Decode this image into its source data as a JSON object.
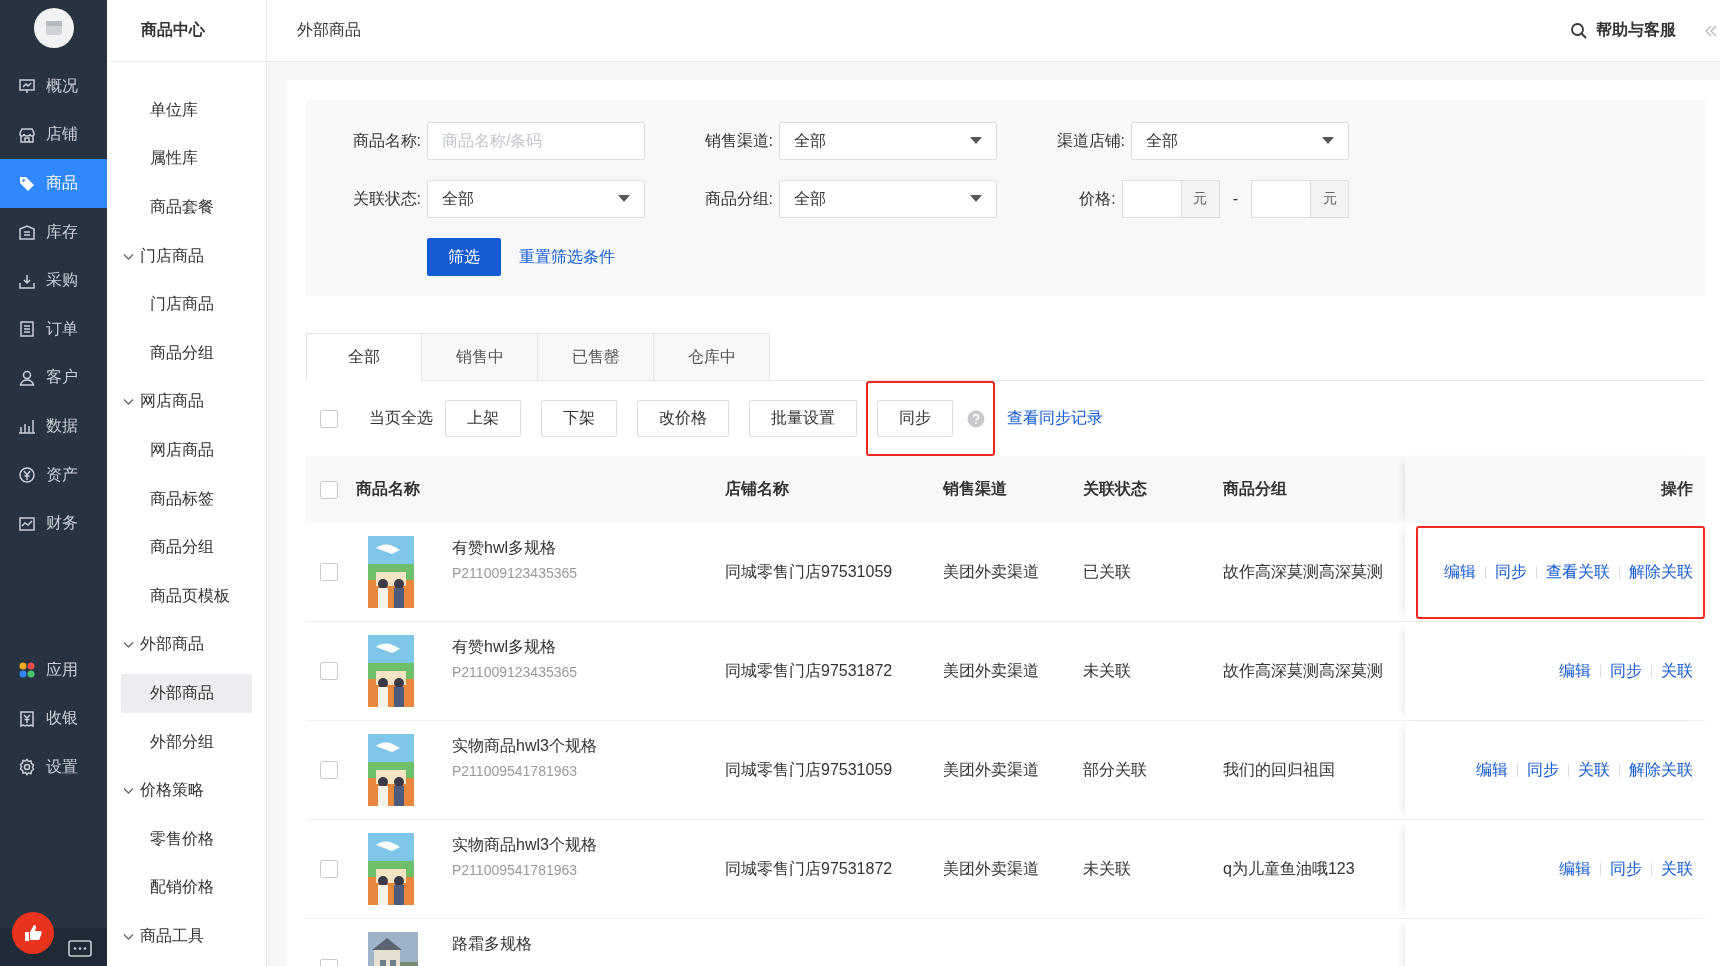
{
  "nav": {
    "items": [
      {
        "label": "概况",
        "selected": false
      },
      {
        "label": "店铺",
        "selected": false
      },
      {
        "label": "商品",
        "selected": true
      },
      {
        "label": "库存",
        "selected": false
      },
      {
        "label": "采购",
        "selected": false
      },
      {
        "label": "订单",
        "selected": false
      },
      {
        "label": "客户",
        "selected": false
      },
      {
        "label": "数据",
        "selected": false
      },
      {
        "label": "资产",
        "selected": false
      },
      {
        "label": "财务",
        "selected": false
      }
    ],
    "bottom_items": [
      {
        "label": "应用",
        "selected": false
      },
      {
        "label": "收银",
        "selected": false
      },
      {
        "label": "设置",
        "selected": false
      }
    ]
  },
  "submenu": {
    "title": "商品中心",
    "items": [
      {
        "label": "单位库",
        "selected": false
      },
      {
        "label": "属性库",
        "selected": false
      },
      {
        "label": "商品套餐",
        "selected": false
      },
      {
        "label": "门店商品",
        "expanded": true,
        "children": [
          {
            "label": "门店商品",
            "selected": false
          },
          {
            "label": "商品分组",
            "selected": false
          }
        ]
      },
      {
        "label": "网店商品",
        "expanded": true,
        "children": [
          {
            "label": "网店商品",
            "selected": false
          },
          {
            "label": "商品标签",
            "selected": false
          },
          {
            "label": "商品分组",
            "selected": false
          },
          {
            "label": "商品页模板",
            "selected": false
          }
        ]
      },
      {
        "label": "外部商品",
        "expanded": true,
        "children": [
          {
            "label": "外部商品",
            "selected": true
          },
          {
            "label": "外部分组",
            "selected": false
          }
        ]
      },
      {
        "label": "价格策略",
        "expanded": true,
        "children": [
          {
            "label": "零售价格",
            "selected": false
          },
          {
            "label": "配销价格",
            "selected": false
          }
        ]
      },
      {
        "label": "商品工具",
        "expanded": true
      }
    ]
  },
  "header": {
    "title": "外部商品",
    "help": "帮助与客服"
  },
  "filters": [
    {
      "kind": "text",
      "label": "商品名称:",
      "placeholder": "商品名称/条码"
    },
    {
      "kind": "select",
      "label": "销售渠道:",
      "value": "全部"
    },
    {
      "kind": "select",
      "label": "渠道店铺:",
      "value": "全部"
    },
    {
      "kind": "select",
      "label": "关联状态:",
      "value": "全部"
    },
    {
      "kind": "select",
      "label": "商品分组:",
      "value": "全部"
    },
    {
      "kind": "range",
      "label": "价格:",
      "units": [
        "元",
        "元"
      ],
      "separator": "-"
    }
  ],
  "filter_buttons": [
    {
      "kind": "primary",
      "label": "筛选"
    },
    {
      "kind": "link",
      "label": "重置筛选条件"
    }
  ],
  "tabs": [
    {
      "label": "全部",
      "selected": true
    },
    {
      "label": "销售中",
      "selected": false
    },
    {
      "label": "已售罄",
      "selected": false
    },
    {
      "label": "仓库中",
      "selected": false
    }
  ],
  "toolbar": {
    "select_all": {
      "label": "当页全选",
      "checked": false
    },
    "buttons": [
      {
        "label": "上架",
        "highlighted": false
      },
      {
        "label": "下架",
        "highlighted": false
      },
      {
        "label": "改价格",
        "highlighted": false
      },
      {
        "label": "批量设置",
        "highlighted": false
      },
      {
        "label": "同步",
        "highlighted": true
      }
    ],
    "link": "查看同步记录"
  },
  "table": {
    "header_checked": false,
    "columns": [
      "商品名称",
      "店铺名称",
      "销售渠道",
      "关联状态",
      "商品分组",
      "操作"
    ],
    "rows": [
      {
        "checked": false,
        "name": "有赞hwl多规格",
        "code": "P211009123435365",
        "store": "同城零售门店97531059",
        "channel": "美团外卖渠道",
        "status": "已关联",
        "group": "故作高深莫测高深莫测",
        "actions": [
          "编辑",
          "同步",
          "查看关联",
          "解除关联"
        ],
        "highlighted": true
      },
      {
        "checked": false,
        "name": "有赞hwl多规格",
        "code": "P211009123435365",
        "store": "同城零售门店97531872",
        "channel": "美团外卖渠道",
        "status": "未关联",
        "group": "故作高深莫测高深莫测",
        "actions": [
          "编辑",
          "同步",
          "关联"
        ],
        "highlighted": false
      },
      {
        "checked": false,
        "name": "实物商品hwl3个规格",
        "code": "P211009541781963",
        "store": "同城零售门店97531059",
        "channel": "美团外卖渠道",
        "status": "部分关联",
        "group": "我们的回归祖国",
        "actions": [
          "编辑",
          "同步",
          "关联",
          "解除关联"
        ],
        "highlighted": false
      },
      {
        "checked": false,
        "name": "实物商品hwl3个规格",
        "code": "P211009541781963",
        "store": "同城零售门店97531872",
        "channel": "美团外卖渠道",
        "status": "未关联",
        "group": "q为儿童鱼油哦123",
        "actions": [
          "编辑",
          "同步",
          "关联"
        ],
        "highlighted": false
      },
      {
        "checked": false,
        "name": "路霜多规格",
        "highlighted": false
      }
    ]
  }
}
